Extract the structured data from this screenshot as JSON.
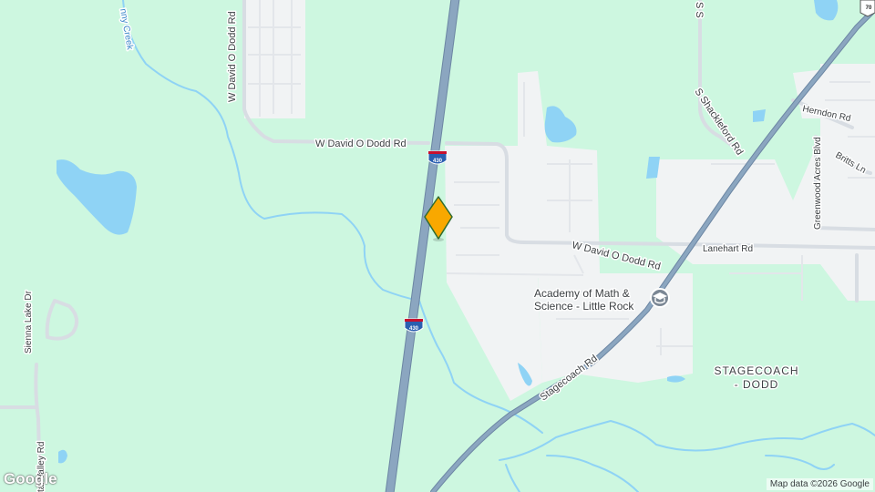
{
  "map": {
    "colors": {
      "land": "#cdf7e0",
      "developed": "#f1f3f4",
      "water": "#8fd3f5",
      "highway": "#8ba6c0",
      "minor_road": "#d8dde3",
      "marker_fill": "#f9a800",
      "marker_stroke": "#2f6b2f"
    },
    "roads": {
      "w_david_o_dodd_rd_west": "W David O Dodd Rd",
      "w_david_o_dodd_rd_east": "W David O Dodd Rd",
      "w_david_o_dodd_rd_north": "W David O Dodd Rd",
      "s_shackleford_rd": "S Shackleford Rd",
      "s_shackleford_top": "S S",
      "herndon_rd": "Herndon Rd",
      "greenwood_acres_blvd": "Greenwood Acres Blvd",
      "britts_ln": "Britts Ln",
      "lanehart_rd": "Lanehart Rd",
      "stagecoach_rd": "Stagecoach Rd",
      "sienna_lake_dr": "Sienna Lake Dr",
      "tal_valley_rd": "tal Valley Rd"
    },
    "water": {
      "creek_label": "nny Creek"
    },
    "shields": {
      "i430_upper": "430",
      "i430_lower": "430",
      "us70": "70"
    },
    "poi": {
      "name_line1": "Academy of Math &",
      "name_line2": "Science - Little Rock",
      "icon": "school-icon"
    },
    "area": {
      "line1": "STAGECOACH",
      "line2": "- DODD"
    },
    "marker": {
      "icon": "location-pin-icon"
    },
    "logo": "Google",
    "attribution": "Map data ©2026 Google"
  }
}
